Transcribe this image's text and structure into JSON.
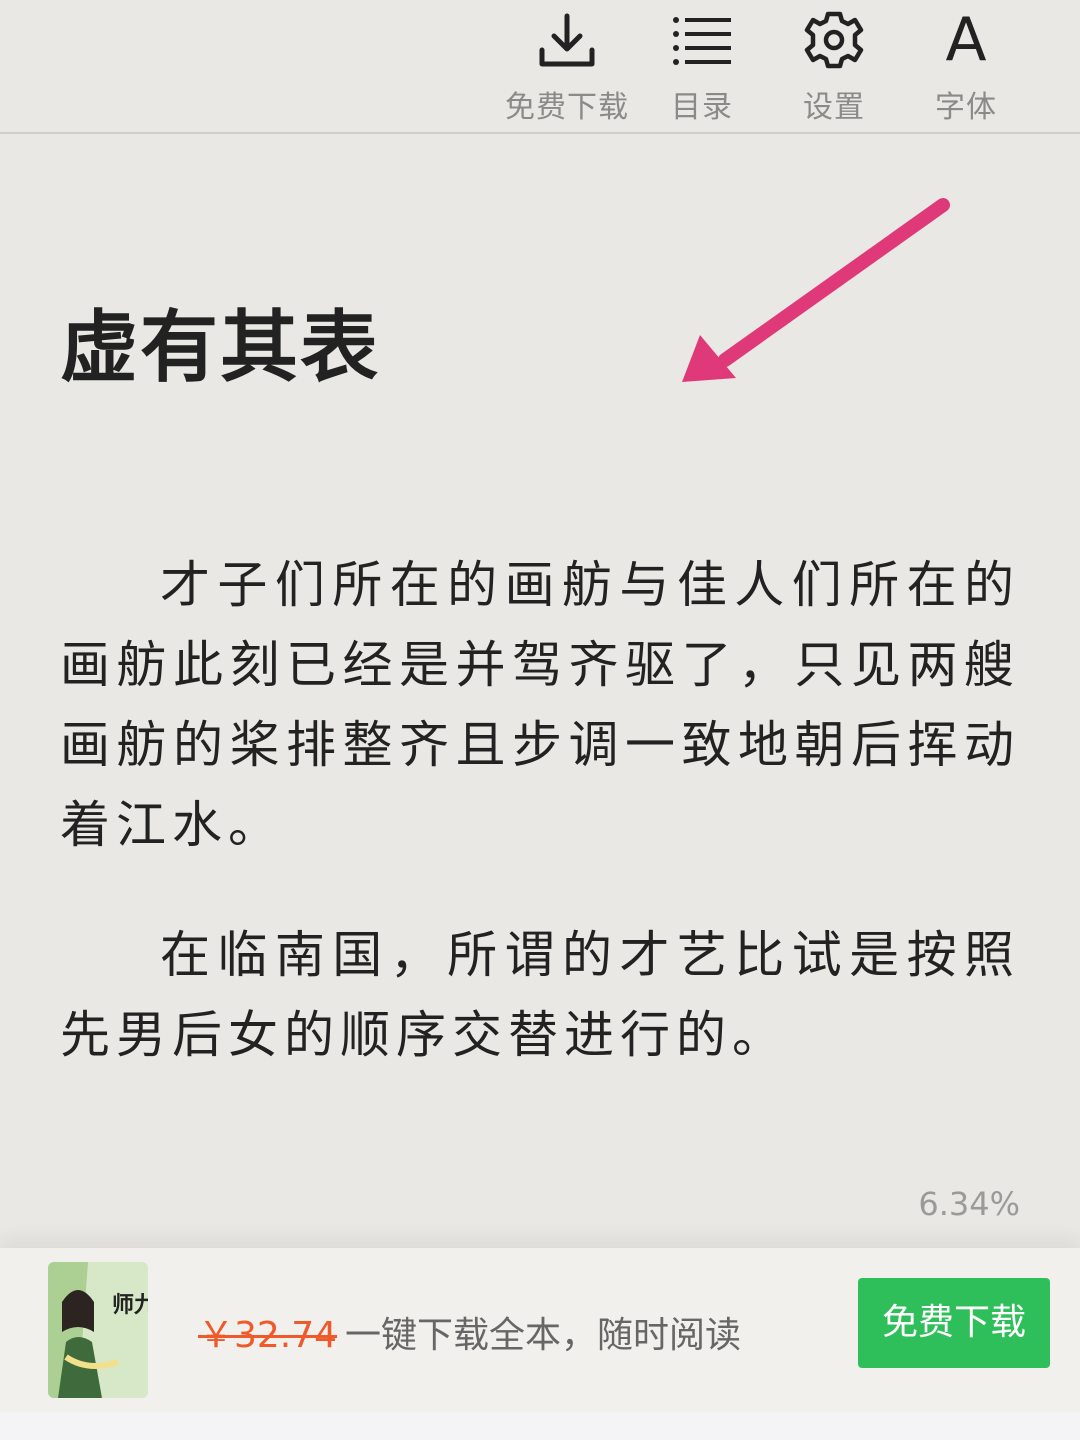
{
  "toolbar": {
    "download_label": "免费下载",
    "toc_label": "目录",
    "settings_label": "设置",
    "font_label": "字体",
    "font_glyph": "A"
  },
  "chapter": {
    "title": "虚有其表",
    "paragraphs": [
      "才子们所在的画舫与佳人们所在的画舫此刻已经是并驾齐驱了，只见两艘画舫的桨排整齐且步调一致地朝后挥动着江水。",
      "在临南国，所谓的才艺比试是按照先男后女的顺序交替进行的。"
    ]
  },
  "progress": "6.34%",
  "promo_bar": {
    "cover_title": "师九妹",
    "original_price": "￥32.74",
    "promo_text": "一键下载全本，随时阅读",
    "button_label": "免费下载"
  },
  "colors": {
    "background": "#e9e8e4",
    "accent_green": "#2fbf5a",
    "price_orange": "#f05a2a",
    "arrow_pink": "#e0397a"
  }
}
